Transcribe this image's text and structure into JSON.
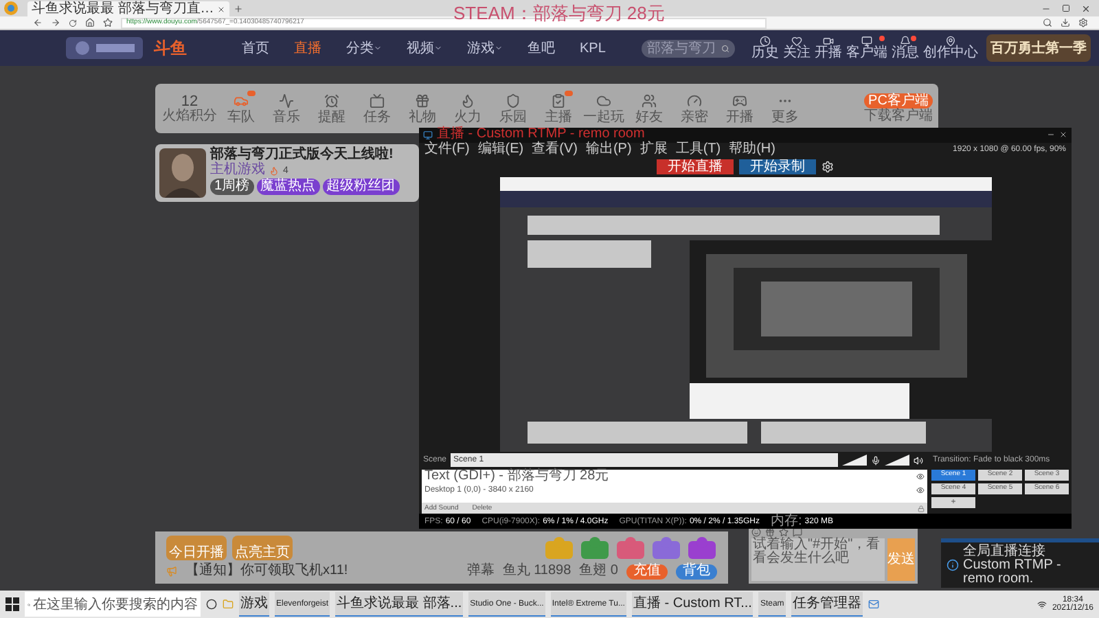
{
  "browser": {
    "tab_title": "斗鱼求说最最 部落与弯刀直…",
    "url_host": "https://www.douyu.com",
    "url_path": "/5647567_=0.14030485740796217",
    "overlay_text": "STEAM：部落与弯刀 28元"
  },
  "site_nav": {
    "logo": "斗鱼",
    "links": [
      {
        "label": "首页",
        "selected": false,
        "dropdown": false
      },
      {
        "label": "直播",
        "selected": true,
        "dropdown": false
      },
      {
        "label": "分类",
        "selected": false,
        "dropdown": true
      },
      {
        "label": "视频",
        "selected": false,
        "dropdown": true
      },
      {
        "label": "游戏",
        "selected": false,
        "dropdown": true
      },
      {
        "label": "鱼吧",
        "selected": false,
        "dropdown": false
      },
      {
        "label": "KPL",
        "selected": false,
        "dropdown": false
      }
    ],
    "search": {
      "placeholder": "部落与弯刀"
    },
    "actions": [
      {
        "label": "历史",
        "badge": false
      },
      {
        "label": "关注",
        "badge": false
      },
      {
        "label": "开播",
        "badge": false
      },
      {
        "label": "客户端",
        "badge": true
      },
      {
        "label": "消息",
        "badge": true
      },
      {
        "label": "创作中心",
        "badge": false
      }
    ],
    "banner": "百万勇士第一季"
  },
  "toolbar": {
    "points": "12",
    "points_label": "火焰积分",
    "items": [
      {
        "label": "车队",
        "badge": true
      },
      {
        "label": "音乐",
        "badge": false
      },
      {
        "label": "提醒",
        "badge": false
      },
      {
        "label": "任务",
        "badge": false
      },
      {
        "label": "礼物",
        "badge": false
      },
      {
        "label": "火力",
        "badge": false
      },
      {
        "label": "乐园",
        "badge": false
      },
      {
        "label": "主播",
        "badge": true
      },
      {
        "label": "一起玩",
        "badge": false
      },
      {
        "label": "好友",
        "badge": false
      },
      {
        "label": "亲密",
        "badge": false
      },
      {
        "label": "开播",
        "badge": false
      },
      {
        "label": "更多",
        "badge": false
      }
    ],
    "client_button": "PC客户端",
    "client_note": "下载客户端"
  },
  "streamer": {
    "title": "部落与弯刀正式版今天上线啦!",
    "category": "主机游戏",
    "heat": "4",
    "tags": [
      {
        "label": "1周榜",
        "color": "#555555"
      },
      {
        "label": "魔蓝热点",
        "color": "#7a3fcf"
      },
      {
        "label": "超级粉丝团",
        "color": "#7a3fcf"
      }
    ]
  },
  "gift_bar": {
    "badges": [
      {
        "label": "今日开播"
      },
      {
        "label": "点亮主页"
      }
    ],
    "gifts": [
      {
        "color": "#d9a520"
      },
      {
        "color": "#3f9a4a"
      },
      {
        "color": "#d85a7a"
      },
      {
        "color": "#8a6ad8"
      },
      {
        "color": "#9a3fcf"
      }
    ],
    "notice": "【通知】你可领取飞机x11!",
    "stats": [
      "弹幕",
      "鱼丸 11898",
      "鱼翅 0"
    ],
    "buttons": [
      {
        "label": "充值",
        "color": "#e8612c"
      },
      {
        "label": "背包",
        "color": "#3a7fd0"
      }
    ]
  },
  "chat": {
    "placeholder": "试着输入\"#开始\"，看看会发生什么吧",
    "send": "发送"
  },
  "obs": {
    "title": "直播 - Custom RTMP - remo room",
    "menus": [
      "文件(F)",
      "编辑(E)",
      "查看(V)",
      "输出(P)",
      "扩展",
      "工具(T)",
      "帮助(H)"
    ],
    "stream_button": "开始直播",
    "record_button": "开始录制",
    "canvas_info": "1920 x 1080 @ 60.00 fps, 90%",
    "scene_label": "Scene",
    "scene_value": "Scene 1",
    "transition": "Transition: Fade to black 300ms",
    "sources": [
      {
        "label": "Text (GDI+) - 部落与弯刀 28元",
        "visible": true
      },
      {
        "label": "Desktop 1 (0,0) - 3840 x 2160",
        "visible": true
      }
    ],
    "source_buttons": [
      "Add Sound",
      "Delete"
    ],
    "scenes": [
      {
        "label": "Scene 1",
        "selected": true
      },
      {
        "label": "Scene 2",
        "selected": false
      },
      {
        "label": "Scene 3",
        "selected": false
      },
      {
        "label": "Scene 4",
        "selected": false
      },
      {
        "label": "Scene 5",
        "selected": false
      },
      {
        "label": "Scene 6",
        "selected": false
      }
    ],
    "add_scene": "+",
    "status": [
      {
        "label": "FPS:",
        "value": "60 / 60"
      },
      {
        "label": "CPU(i9-7900X):",
        "value": "6% / 1% / 4.0GHz"
      },
      {
        "label": "GPU(TITAN X(P)):",
        "value": "0% / 2% / 1.35GHz"
      },
      {
        "label": "内存:",
        "value": "320 MB"
      }
    ]
  },
  "notification": {
    "text": "全局直播连接 Custom RTMP - remo room."
  },
  "taskbar": {
    "search": {
      "placeholder": "在这里输入你要搜索的内容"
    },
    "apps": [
      "游戏",
      "Elevenforgeist",
      "斗鱼求说最最 部落...",
      "Studio One - Buck...",
      "Intel® Extreme Tu...",
      "直播 - Custom RT...",
      "Steam",
      "任务管理器"
    ],
    "time": "18:34",
    "date": "2021/12/16"
  }
}
